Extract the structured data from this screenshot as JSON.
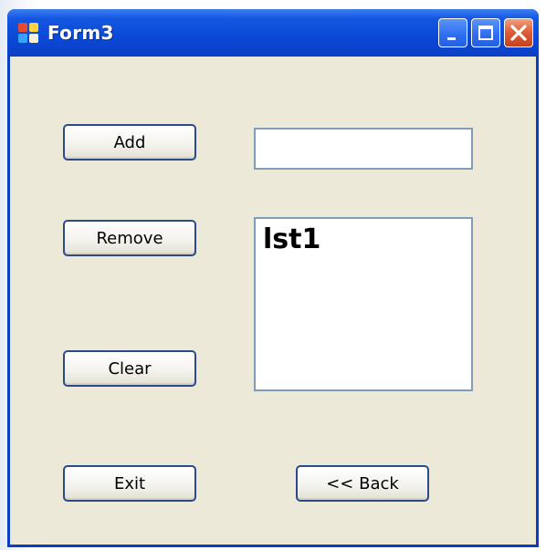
{
  "window": {
    "title": "Form3",
    "icon": "form-app-icon",
    "controls": {
      "minimize": "minimize-icon",
      "maximize": "maximize-icon",
      "close": "close-icon"
    }
  },
  "buttons": {
    "add": "Add",
    "remove": "Remove",
    "clear": "Clear",
    "exit": "Exit",
    "back": "<< Back"
  },
  "textbox": {
    "value": ""
  },
  "listbox": {
    "items": [
      "lst1"
    ]
  },
  "colors": {
    "titlebar": "#0a49d7",
    "client": "#ece9d8",
    "button_border": "#2a4a8a",
    "input_border": "#7f9db9",
    "close_button": "#dd5a34"
  }
}
